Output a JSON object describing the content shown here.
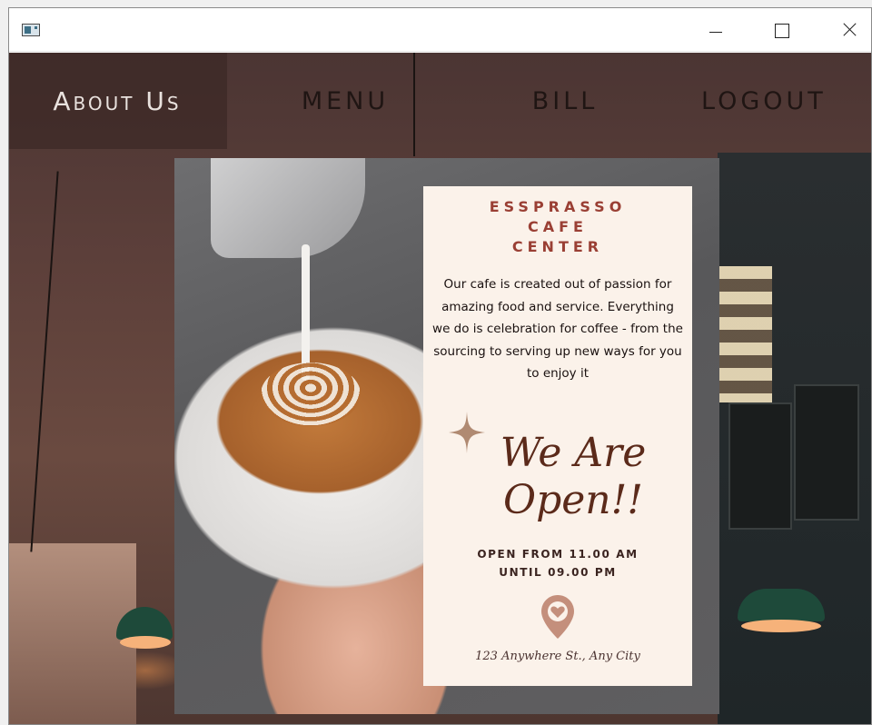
{
  "window": {
    "app_icon": "window-app-icon",
    "controls": [
      "minimize-icon",
      "maximize-icon",
      "close-icon"
    ]
  },
  "nav": {
    "about": "About Us",
    "menu": "MENU",
    "bill": "BILL",
    "logout": "LOGOUT",
    "active_tab": "About Us"
  },
  "card": {
    "title_line1": "ESSPRASSO",
    "title_line2": "CAFE",
    "title_line3": "CENTER",
    "description": "Our cafe is created out of passion for amazing food and service. Everything we do is celebration for coffee - from the sourcing to serving up new ways for you to enjoy it",
    "open_line1": "We Are",
    "open_line2": "Open!!",
    "hours_line1": "OPEN FROM 11.00 AM",
    "hours_line2": "UNTIL 09.00 PM",
    "address": "123 Anywhere St., Any City"
  },
  "colors": {
    "title": "#9a3f34",
    "open_title": "#5b2a1a",
    "pin": "#c48f7c",
    "card_bg": "#fbf2ea"
  }
}
